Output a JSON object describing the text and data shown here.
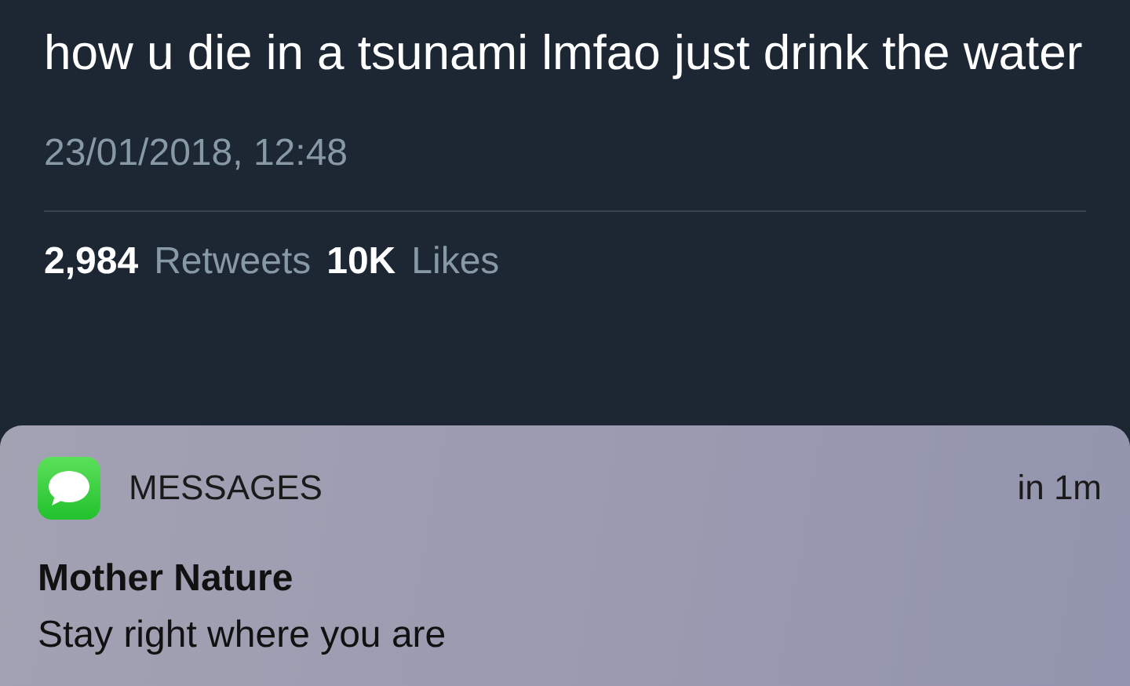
{
  "tweet": {
    "text": "how u die in a tsunami lmfao just drink the water",
    "timestamp": "23/01/2018, 12:48",
    "stats": [
      {
        "count": "2,984",
        "label": "Retweets"
      },
      {
        "count": "10K",
        "label": "Likes"
      }
    ]
  },
  "notification": {
    "app": "MESSAGES",
    "time": "in 1m",
    "sender": "Mother Nature",
    "message": "Stay right where you are"
  }
}
